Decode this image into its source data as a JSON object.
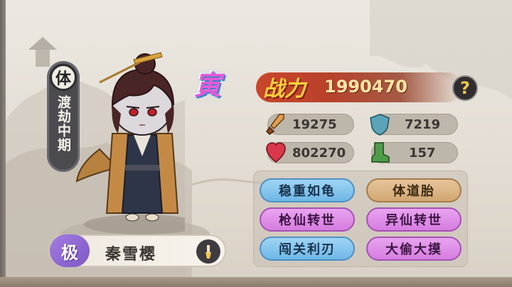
{
  "character": {
    "realm_type": "体",
    "realm_name": "渡劫中期",
    "grade": "寅",
    "quality": "极",
    "name": "秦雪樱"
  },
  "power": {
    "label": "战力",
    "value": "1990470",
    "help_label": "?"
  },
  "stats": {
    "attack": "19275",
    "defense": "7219",
    "health": "802270",
    "speed": "157"
  },
  "traits": [
    {
      "label": "稳重如龟",
      "color": "blue"
    },
    {
      "label": "体道胎",
      "color": "gold"
    },
    {
      "label": "枪仙转世",
      "color": "pink"
    },
    {
      "label": "异仙转世",
      "color": "pink"
    },
    {
      "label": "闯关利刃",
      "color": "blue"
    },
    {
      "label": "大偷大摸",
      "color": "pink"
    }
  ],
  "icons": {
    "attack": "sword-icon",
    "defense": "shield-icon",
    "health": "heart-icon",
    "speed": "boot-icon",
    "rename": "brush-icon"
  }
}
